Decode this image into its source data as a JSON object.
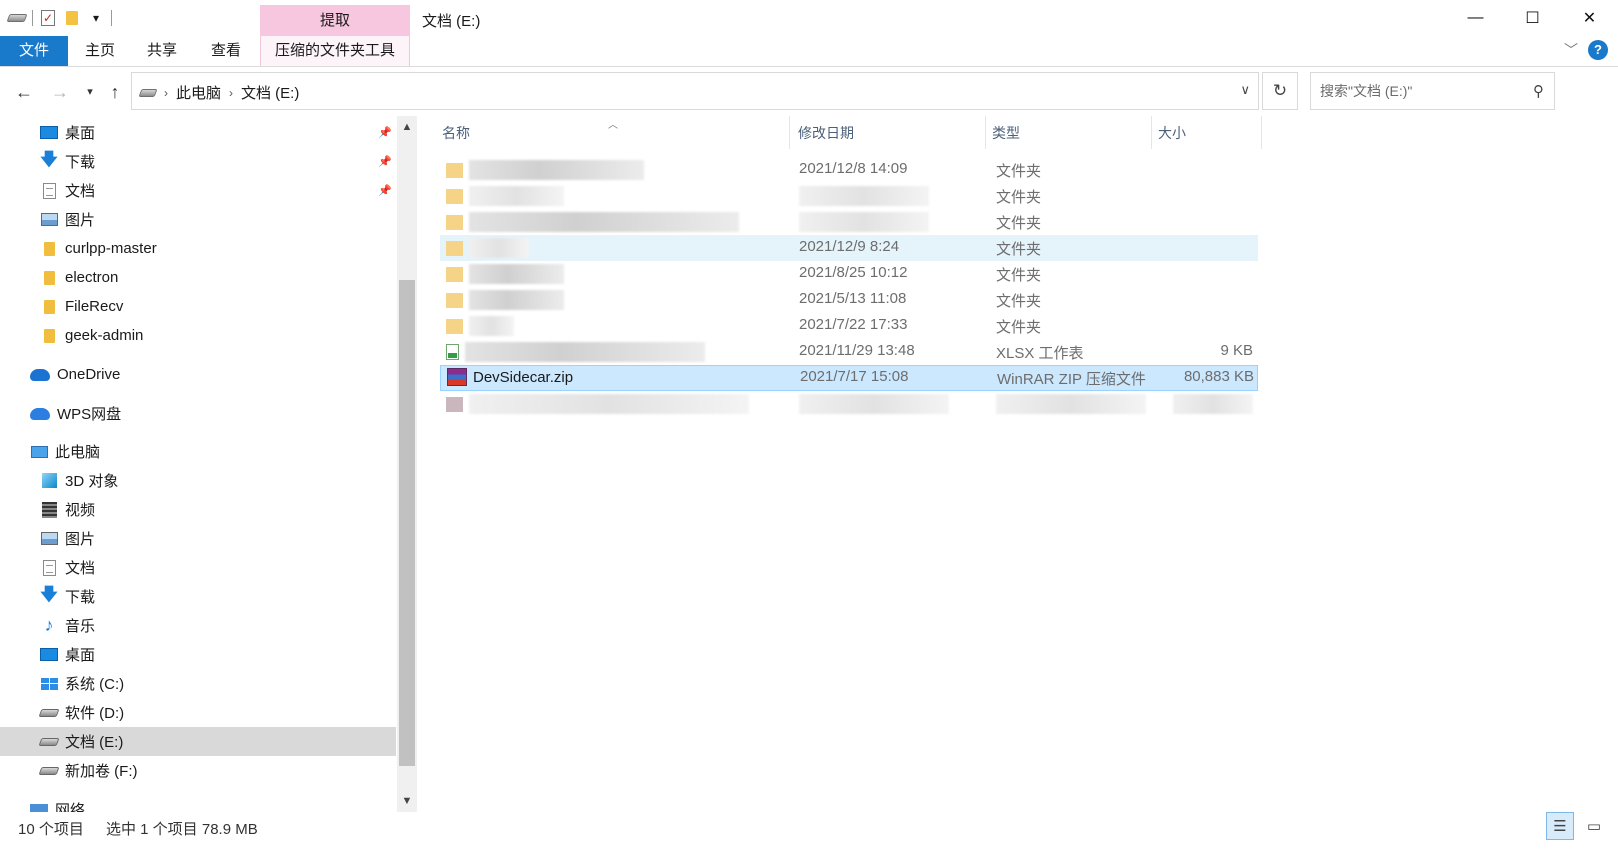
{
  "window": {
    "title": "文档 (E:)",
    "minimize_glyph": "—",
    "maximize_glyph": "☐",
    "close_glyph": "✕"
  },
  "ribbon": {
    "context_group": "提取",
    "tabs": [
      "文件",
      "主页",
      "共享",
      "查看",
      "压缩的文件夹工具"
    ]
  },
  "address": {
    "crumbs": [
      "此电脑",
      "文档 (E:)"
    ],
    "search_placeholder": "搜索\"文档 (E:)\""
  },
  "nav_pane": {
    "quick_access": [
      {
        "label": "桌面",
        "icon": "desktop-icon",
        "pinned": true
      },
      {
        "label": "下载",
        "icon": "download-icon",
        "pinned": true
      },
      {
        "label": "文档",
        "icon": "documents-icon",
        "pinned": true
      },
      {
        "label": "图片",
        "icon": "pictures-icon",
        "pinned": false
      },
      {
        "label": "curlpp-master",
        "icon": "folder-icon",
        "pinned": false
      },
      {
        "label": "electron",
        "icon": "folder-icon",
        "pinned": false
      },
      {
        "label": "FileRecv",
        "icon": "folder-icon",
        "pinned": false
      },
      {
        "label": "geek-admin",
        "icon": "folder-icon",
        "pinned": false
      }
    ],
    "onedrive": "OneDrive",
    "wps": "WPS网盘",
    "this_pc": "此电脑",
    "pc_items": [
      {
        "label": "3D 对象",
        "icon": "3d-objects-icon"
      },
      {
        "label": "视频",
        "icon": "videos-icon"
      },
      {
        "label": "图片",
        "icon": "pictures-icon"
      },
      {
        "label": "文档",
        "icon": "documents-icon"
      },
      {
        "label": "下载",
        "icon": "download-icon"
      },
      {
        "label": "音乐",
        "icon": "music-icon"
      },
      {
        "label": "桌面",
        "icon": "desktop-icon"
      },
      {
        "label": "系统 (C:)",
        "icon": "system-drive-icon"
      },
      {
        "label": "软件 (D:)",
        "icon": "drive-icon"
      },
      {
        "label": "文档 (E:)",
        "icon": "drive-icon",
        "selected": true
      },
      {
        "label": "新加卷 (F:)",
        "icon": "drive-icon"
      }
    ],
    "network": "网络"
  },
  "columns": {
    "name": "名称",
    "date": "修改日期",
    "type": "类型",
    "size": "大小"
  },
  "files": [
    {
      "name": "",
      "date": "2021/12/8 14:09",
      "type": "文件夹",
      "size": "",
      "icon": "folder-icon",
      "redacted": true
    },
    {
      "name": "",
      "date": "",
      "type": "文件夹",
      "size": "",
      "icon": "folder-icon",
      "redacted": true
    },
    {
      "name": "",
      "date": "",
      "type": "文件夹",
      "size": "",
      "icon": "folder-icon",
      "redacted": true
    },
    {
      "name": "",
      "date": "2021/12/9 8:24",
      "type": "文件夹",
      "size": "",
      "icon": "folder-icon",
      "redacted": true,
      "hover": true
    },
    {
      "name": "",
      "date": "2021/8/25 10:12",
      "type": "文件夹",
      "size": "",
      "icon": "folder-icon",
      "redacted": true
    },
    {
      "name": "",
      "date": "2021/5/13 11:08",
      "type": "文件夹",
      "size": "",
      "icon": "folder-icon",
      "redacted": true
    },
    {
      "name": "",
      "date": "2021/7/22 17:33",
      "type": "文件夹",
      "size": "",
      "icon": "folder-icon",
      "redacted": true
    },
    {
      "name": "",
      "date": "2021/11/29 13:48",
      "type": "XLSX 工作表",
      "size": "9 KB",
      "icon": "xlsx-icon",
      "redacted": true
    },
    {
      "name": "DevSidecar.zip",
      "date": "2021/7/17 15:08",
      "type": "WinRAR ZIP 压缩文件",
      "size": "80,883 KB",
      "icon": "winrar-icon",
      "selected": true
    },
    {
      "name": "",
      "date": "",
      "type": "",
      "size": "",
      "icon": "file-icon",
      "redacted": true
    }
  ],
  "status": {
    "count": "10 个项目",
    "selection": "选中 1 个项目  78.9 MB"
  }
}
